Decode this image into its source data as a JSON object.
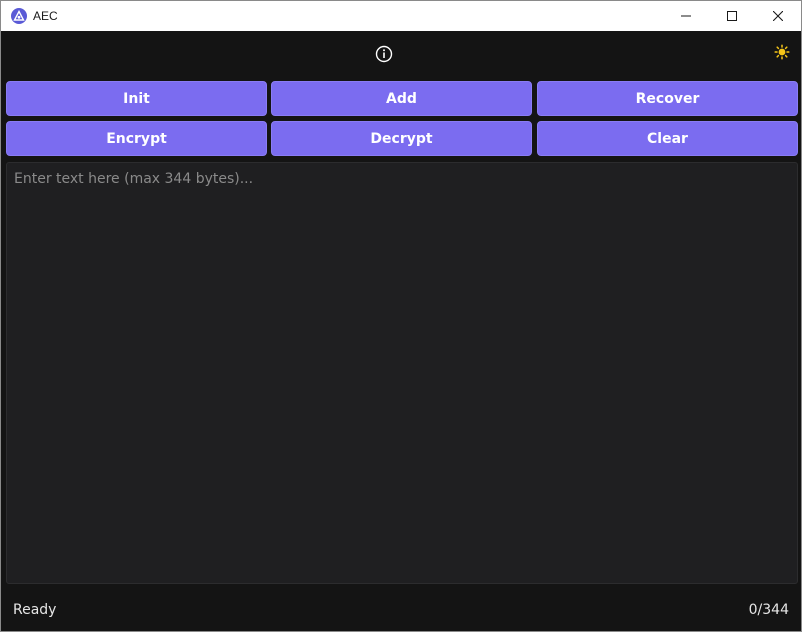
{
  "window": {
    "title": "AEC",
    "icons": {
      "app": "aec-app-icon",
      "minimize": "minimize-icon",
      "maximize": "maximize-icon",
      "close": "close-icon"
    }
  },
  "header": {
    "icons": {
      "info": "info-icon",
      "theme": "sun-icon"
    },
    "theme_color": "#f5c518"
  },
  "actions": {
    "init": "Init",
    "add": "Add",
    "recover": "Recover",
    "encrypt": "Encrypt",
    "decrypt": "Decrypt",
    "clear": "Clear",
    "button_color": "#7b6cf0"
  },
  "editor": {
    "value": "",
    "placeholder": "Enter text here (max 344 bytes)..."
  },
  "status": {
    "text": "Ready",
    "count": "0/344"
  }
}
